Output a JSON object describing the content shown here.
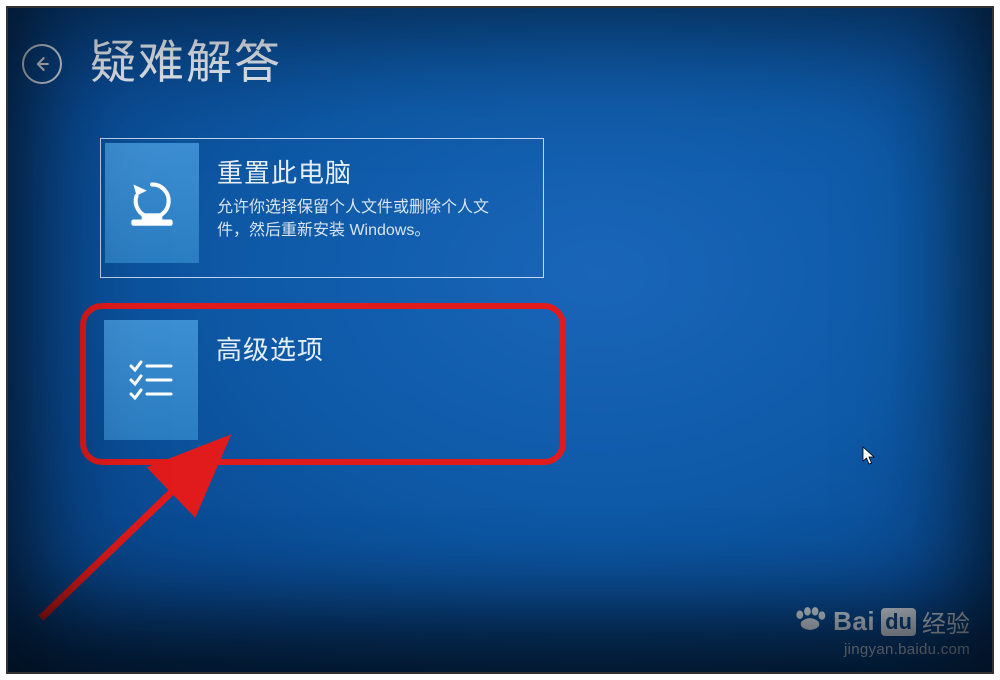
{
  "page": {
    "title": "疑难解答"
  },
  "options": {
    "reset": {
      "title": "重置此电脑",
      "desc": "允许你选择保留个人文件或删除个人文件，然后重新安装 Windows。"
    },
    "advanced": {
      "title": "高级选项"
    }
  },
  "watermark": {
    "brand_prefix": "Bai",
    "brand_box": "du",
    "brand_suffix": "经验",
    "url": "jingyan.baidu.com"
  },
  "annotation": {
    "highlighted_option": "advanced"
  }
}
